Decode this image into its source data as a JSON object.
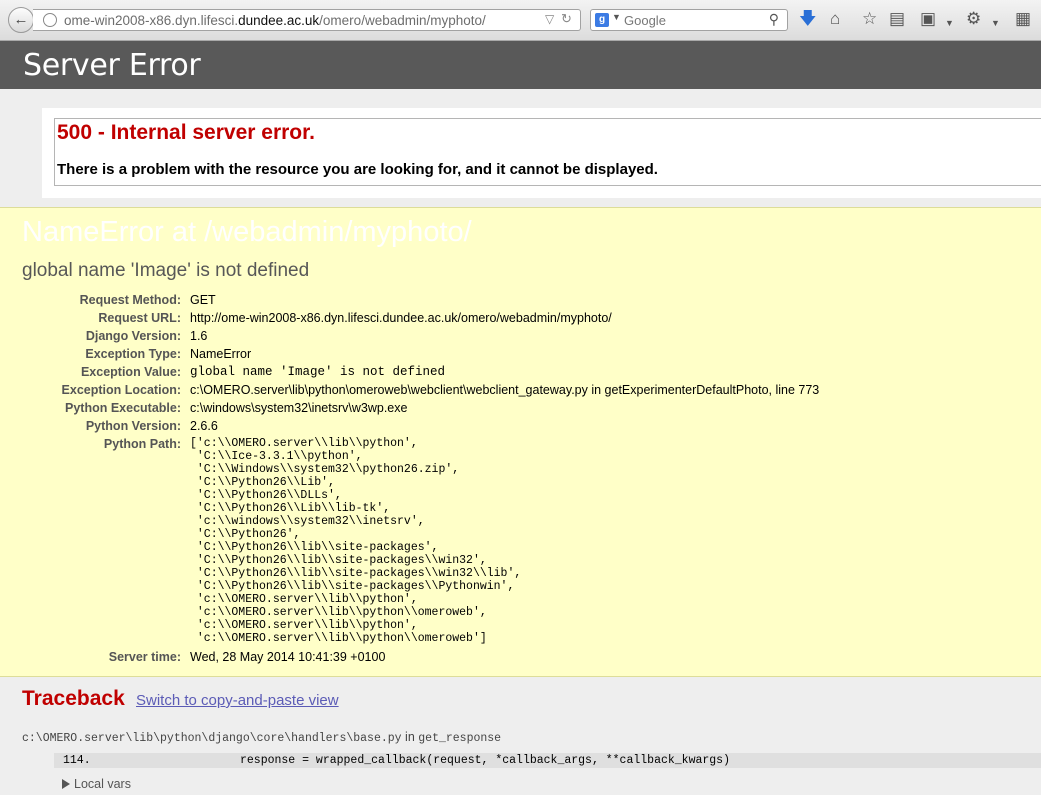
{
  "browser": {
    "url_prefix": "ome-win2008-x86.dyn.lifesci.",
    "url_domain": "dundee.ac.uk",
    "url_path": "/omero/webadmin/myphoto/",
    "search_placeholder": "Google",
    "search_engine_badge": "g"
  },
  "header": {
    "title": "Server Error"
  },
  "error": {
    "heading": "500 - Internal server error.",
    "message": "There is a problem with the resource you are looking for, and it cannot be displayed."
  },
  "summary": {
    "title": "NameError at /webadmin/myphoto/",
    "subtitle": "global name 'Image' is not defined",
    "meta": {
      "request_method": {
        "label": "Request Method:",
        "value": "GET"
      },
      "request_url": {
        "label": "Request URL:",
        "value": "http://ome-win2008-x86.dyn.lifesci.dundee.ac.uk/omero/webadmin/myphoto/"
      },
      "django_version": {
        "label": "Django Version:",
        "value": "1.6"
      },
      "exception_type": {
        "label": "Exception Type:",
        "value": "NameError"
      },
      "exception_value": {
        "label": "Exception Value:",
        "value": "global name 'Image' is not defined"
      },
      "exception_location": {
        "label": "Exception Location:",
        "value": "c:\\OMERO.server\\lib\\python\\omeroweb\\webclient\\webclient_gateway.py in getExperimenterDefaultPhoto, line 773"
      },
      "python_executable": {
        "label": "Python Executable:",
        "value": "c:\\windows\\system32\\inetsrv\\w3wp.exe"
      },
      "python_version": {
        "label": "Python Version:",
        "value": "2.6.6"
      },
      "python_path": {
        "label": "Python Path:",
        "lines": [
          "['c:\\\\OMERO.server\\\\lib\\\\python',",
          " 'C:\\\\Ice-3.3.1\\\\python',",
          " 'C:\\\\Windows\\\\system32\\\\python26.zip',",
          " 'C:\\\\Python26\\\\Lib',",
          " 'C:\\\\Python26\\\\DLLs',",
          " 'C:\\\\Python26\\\\Lib\\\\lib-tk',",
          " 'c:\\\\windows\\\\system32\\\\inetsrv',",
          " 'C:\\\\Python26',",
          " 'C:\\\\Python26\\\\lib\\\\site-packages',",
          " 'C:\\\\Python26\\\\lib\\\\site-packages\\\\win32',",
          " 'C:\\\\Python26\\\\lib\\\\site-packages\\\\win32\\\\lib',",
          " 'C:\\\\Python26\\\\lib\\\\site-packages\\\\Pythonwin',",
          " 'c:\\\\OMERO.server\\\\lib\\\\python',",
          " 'c:\\\\OMERO.server\\\\lib\\\\python\\\\omeroweb',",
          " 'c:\\\\OMERO.server\\\\lib\\\\python',",
          " 'c:\\\\OMERO.server\\\\lib\\\\python\\\\omeroweb']"
        ]
      },
      "server_time": {
        "label": "Server time:",
        "value": "Wed, 28 May 2014 10:41:39 +0100"
      }
    }
  },
  "traceback": {
    "heading": "Traceback",
    "switch_link": "Switch to copy-and-paste view",
    "file": "c:\\OMERO.server\\lib\\python\\django\\core\\handlers\\base.py",
    "in_text": "in",
    "function": "get_response",
    "line_number": "114.",
    "code": "response = wrapped_callback(request, *callback_args, **callback_kwargs)",
    "local_vars": "Local vars"
  }
}
